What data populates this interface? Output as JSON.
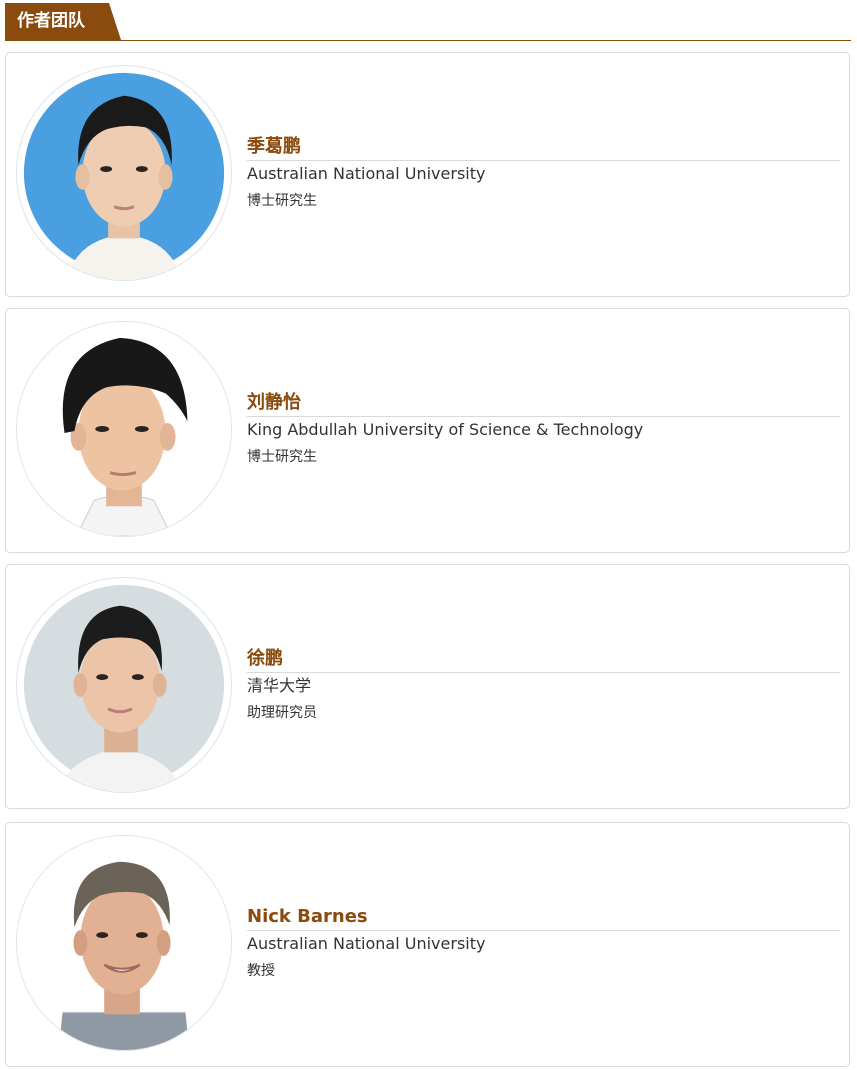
{
  "section": {
    "title": "作者团队"
  },
  "authors": [
    {
      "name": "季葛鹏",
      "affiliation": "Australian National University",
      "position": "博士研究生",
      "photo_icon": "portrait-photo",
      "photo_bg": "#4a9fe0"
    },
    {
      "name": "刘静怡",
      "affiliation": "King Abdullah University of Science & Technology",
      "position": "博士研究生",
      "photo_icon": "portrait-photo",
      "photo_bg": "#ffffff"
    },
    {
      "name": "徐鹏",
      "affiliation": "清华大学",
      "position": "助理研究员",
      "photo_icon": "portrait-photo",
      "photo_bg": "#d6dde0"
    },
    {
      "name": "Nick Barnes",
      "affiliation": "Australian National University",
      "position": "教授",
      "photo_icon": "portrait-photo",
      "photo_bg": "#ffffff"
    }
  ],
  "colors": {
    "accent": "#8a4b0e",
    "text": "#333333",
    "border": "#d9d9d9"
  }
}
